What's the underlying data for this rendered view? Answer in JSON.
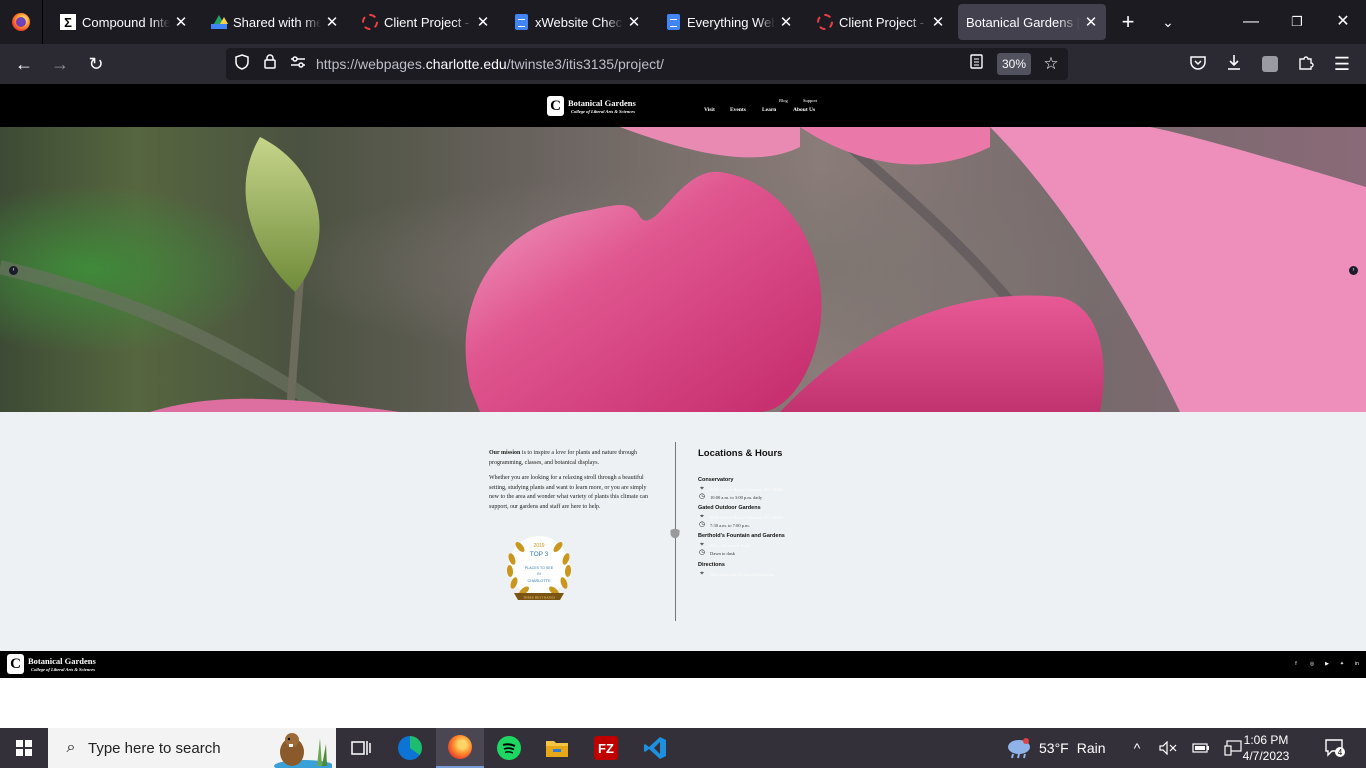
{
  "browser": {
    "tabs": [
      {
        "title": "Compound Interest",
        "icon": "sigma-icon"
      },
      {
        "title": "Shared with me - Google Drive",
        "icon": "google-drive-icon"
      },
      {
        "title": "Client Project - Padlet",
        "icon": "spinner-icon"
      },
      {
        "title": "xWebsite Checklist",
        "icon": "google-docs-icon"
      },
      {
        "title": "Everything Web Writing",
        "icon": "google-docs-icon"
      },
      {
        "title": "Client Project - Padlet",
        "icon": "spinner-icon"
      },
      {
        "title": "Botanical Gardens | Home",
        "icon": "none",
        "active": true
      }
    ],
    "url_prefix": "https://webpages.",
    "url_domain": "charlotte.edu",
    "url_path": "/twinste3/itis3135/project/",
    "zoom": "30%"
  },
  "site": {
    "logo_title": "Botanical Gardens",
    "logo_subtitle": "College of Liberal Arts & Sciences",
    "logo_mark": "C",
    "top_links": [
      "Blog",
      "Support"
    ],
    "nav_links": [
      "Visit",
      "Events",
      "Learn",
      "About Us"
    ],
    "mission_bold": "Our mission",
    "mission_rest": " is to inspire a love for plants and nature through programming, classes, and botanical displays.",
    "mission_p2": "Whether you are looking for a relaxing stroll through a beautiful setting, studying plants and want to learn more, or you are simply new to the area and wonder what variety of plants this climate can support, our gardens and staff are here to help.",
    "badge": {
      "year": "2019",
      "line1": "TOP 3",
      "line2": "PLACES TO SEE",
      "line3": "IN",
      "line4": "CHARLOTTE",
      "ribbon": "THREE BEST RATED"
    },
    "locations_title": "Locations & Hours",
    "locations": [
      {
        "name": "Conservatory",
        "rows": [
          {
            "icon": "map-pin-icon",
            "text": "9090 Craver Road, Charlotte, NC 28262",
            "link": true
          },
          {
            "icon": "clock-icon",
            "text": "10:00 a.m. to 3:00 p.m. daily",
            "link": false
          }
        ]
      },
      {
        "name": "Gated Outdoor Gardens",
        "rows": [
          {
            "icon": "map-pin-icon",
            "text": "9090 Craver Road, Charlotte, NC 28262",
            "link": true
          },
          {
            "icon": "clock-icon",
            "text": "7:30 a.m. to 7:00 p.m.",
            "link": false
          }
        ]
      },
      {
        "name": "Berthold's Fountain and Gardens",
        "rows": [
          {
            "icon": "map-pin-icon",
            "text": "Mary Alexander Road",
            "link": true
          },
          {
            "icon": "clock-icon",
            "text": "Dawn to dusk",
            "link": false
          }
        ]
      },
      {
        "name": "Directions",
        "rows": [
          {
            "icon": "map-pin-icon",
            "text": "Directions and Parking Information",
            "link": true
          }
        ]
      }
    ],
    "footer_title": "Botanical Gardens",
    "footer_subtitle": "College of Liberal Arts & Sciences",
    "social": [
      "facebook-icon",
      "instagram-icon",
      "youtube-icon",
      "twitter-icon",
      "linkedin-icon"
    ]
  },
  "taskbar": {
    "search_placeholder": "Type here to search",
    "weather_temp": "53°F",
    "weather_text": "Rain",
    "time": "1:06 PM",
    "date": "4/7/2023",
    "notifications": "4"
  }
}
